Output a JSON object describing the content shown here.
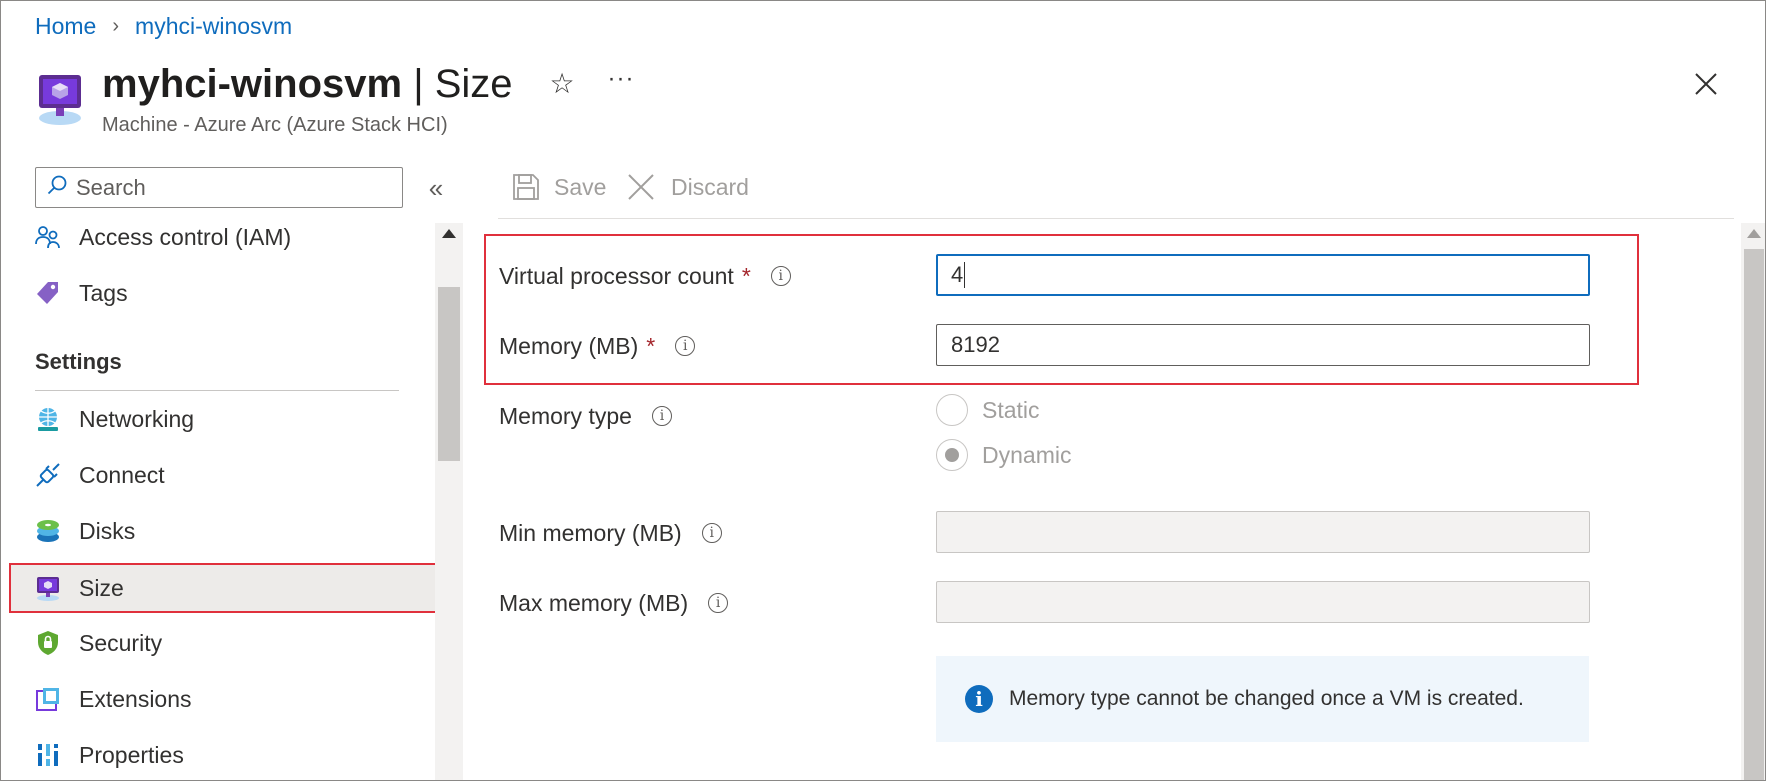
{
  "breadcrumb": {
    "home": "Home",
    "separator": "›",
    "resource": "myhci-winosvm"
  },
  "header": {
    "resource_name": "myhci-winosvm",
    "separator": " | ",
    "page_name": "Size",
    "subtitle": "Machine - Azure Arc (Azure Stack HCI)",
    "favorite_icon": "☆",
    "more_icon": "···",
    "resource_icon": "vm-monitor-icon"
  },
  "sidebar": {
    "search_placeholder": "Search",
    "collapse_icon": "«",
    "items_top": [
      {
        "label": "Access control (IAM)",
        "icon": "people-icon"
      },
      {
        "label": "Tags",
        "icon": "tag-icon"
      }
    ],
    "section_heading": "Settings",
    "items_settings": [
      {
        "label": "Networking",
        "icon": "networking-icon"
      },
      {
        "label": "Connect",
        "icon": "plug-icon"
      },
      {
        "label": "Disks",
        "icon": "disks-icon"
      },
      {
        "label": "Size",
        "icon": "size-icon",
        "selected": true
      },
      {
        "label": "Security",
        "icon": "shield-icon"
      },
      {
        "label": "Extensions",
        "icon": "extensions-icon"
      },
      {
        "label": "Properties",
        "icon": "properties-icon"
      }
    ]
  },
  "toolbar": {
    "save_label": "Save",
    "discard_label": "Discard"
  },
  "form": {
    "vcpu": {
      "label": "Virtual processor count",
      "required_mark": "*",
      "value": "4"
    },
    "memory": {
      "label": "Memory (MB)",
      "required_mark": "*",
      "value": "8192"
    },
    "memory_type": {
      "label": "Memory type",
      "options": [
        {
          "label": "Static",
          "selected": false
        },
        {
          "label": "Dynamic",
          "selected": true
        }
      ]
    },
    "min_memory": {
      "label": "Min memory (MB)",
      "value": ""
    },
    "max_memory": {
      "label": "Max memory (MB)",
      "value": ""
    },
    "info_glyph": "i",
    "info_message": "Memory type cannot be changed once a VM is created."
  },
  "colors": {
    "link": "#0f6cbd",
    "highlight_border": "#e0303c",
    "focus_border": "#0f6cbd",
    "required": "#a4262c",
    "info_bar_bg": "#eff6fc",
    "selected_nav_bg": "#edebe9"
  }
}
